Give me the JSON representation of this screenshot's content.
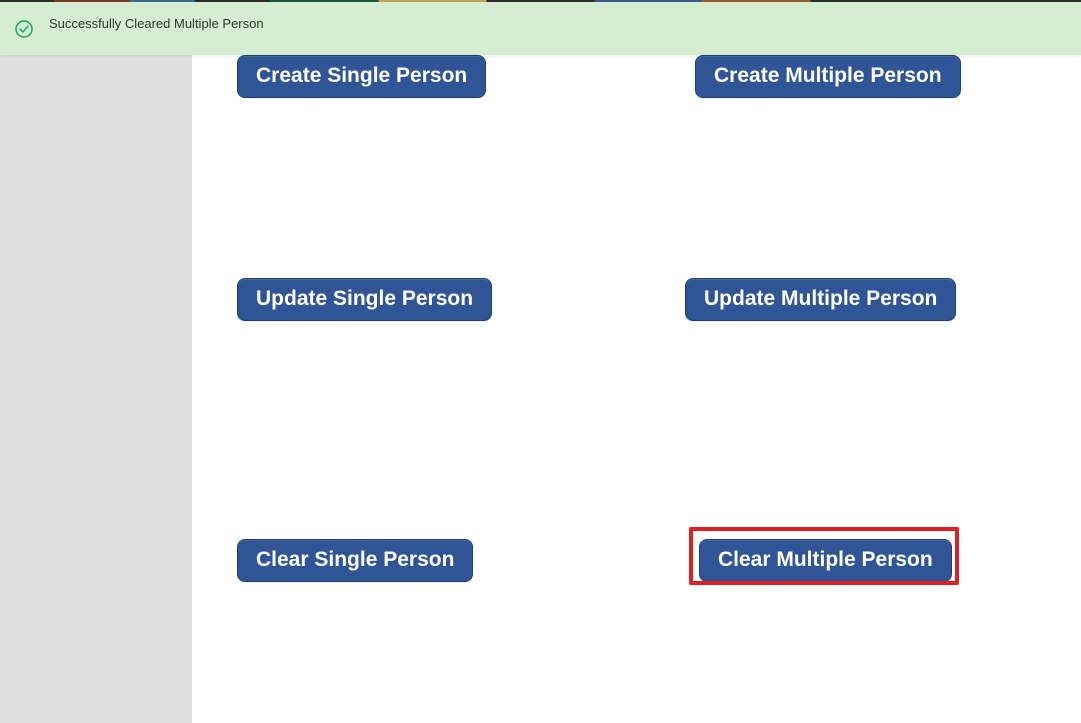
{
  "toast": {
    "message": "Successfully Cleared Multiple Person"
  },
  "buttons": {
    "create_single": "Create Single Person",
    "create_multiple": "Create Multiple Person",
    "update_single": "Update Single Person",
    "update_multiple": "Update Multiple Person",
    "clear_single": "Clear Single Person",
    "clear_multiple": "Clear Multiple Person"
  },
  "colors": {
    "button_bg": "#2f5597",
    "toast_bg": "#d5eed2",
    "highlight": "#e02020",
    "success_icon": "#1aa36a"
  }
}
